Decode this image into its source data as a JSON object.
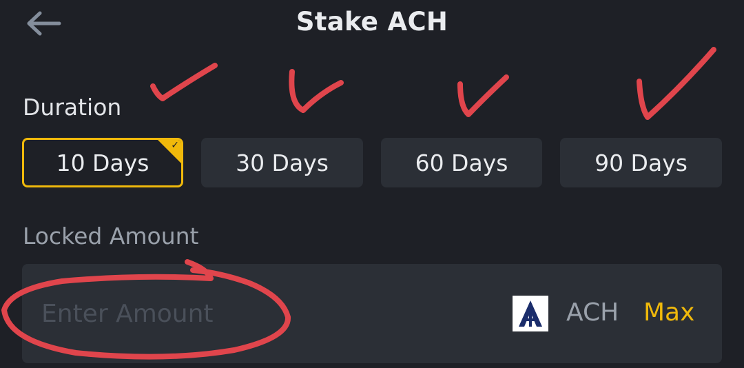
{
  "header": {
    "title": "Stake ACH",
    "back_icon": "arrow-left-icon"
  },
  "duration": {
    "label": "Duration",
    "options": [
      {
        "label": "10 Days",
        "selected": true
      },
      {
        "label": "30 Days",
        "selected": false
      },
      {
        "label": "60 Days",
        "selected": false
      },
      {
        "label": "90 Days",
        "selected": false
      }
    ],
    "selected_check": "✓"
  },
  "locked_amount": {
    "label": "Locked Amount",
    "placeholder": "Enter Amount",
    "value": "",
    "token_symbol": "ACH",
    "token_icon": "ach-token-icon",
    "max_label": "Max"
  },
  "colors": {
    "background": "#1e2026",
    "card": "#2b2f36",
    "accent": "#f0b90b",
    "annotation_red": "#e0454c"
  }
}
